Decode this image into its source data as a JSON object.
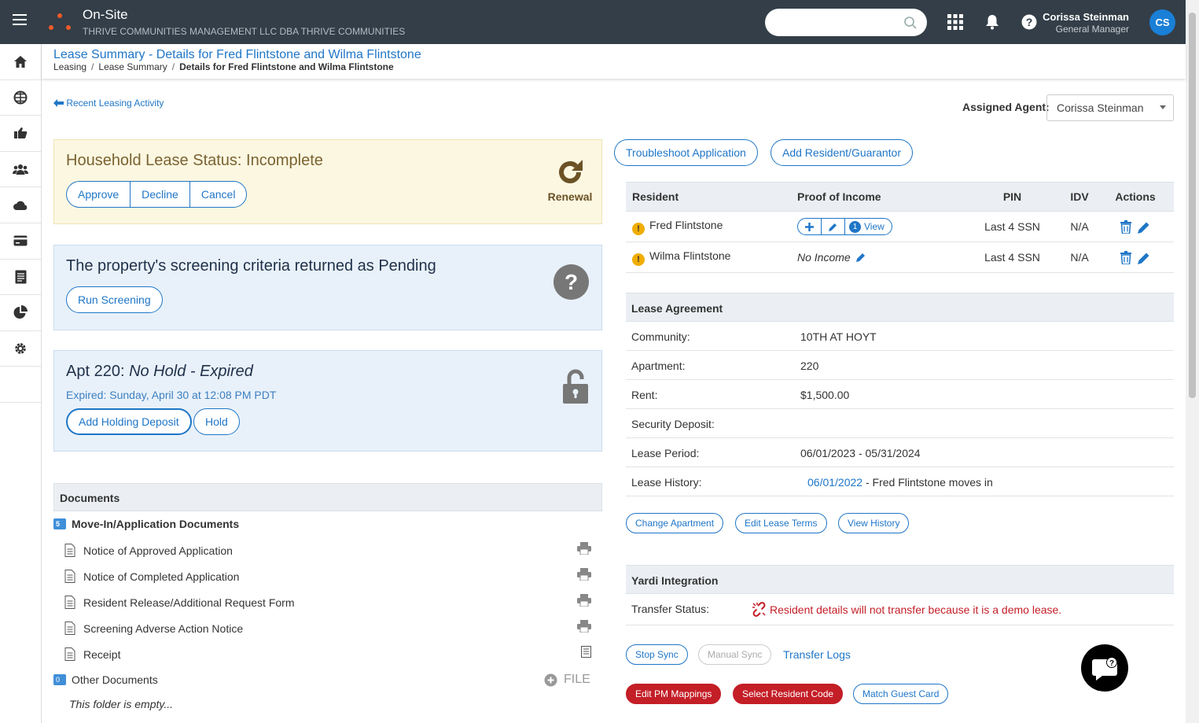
{
  "topbar": {
    "app_name": "On-Site",
    "company": "THRIVE COMMUNITIES MANAGEMENT LLC DBA THRIVE COMMUNITIES",
    "search_placeholder": "",
    "user_name": "Corissa Steinman",
    "user_role": "General Manager",
    "user_initials": "CS"
  },
  "sidebar": {
    "items": [
      "home-icon",
      "globe-icon",
      "thumbs-up-icon",
      "people-icon",
      "cloud-icon",
      "credit-card-icon",
      "document-icon",
      "pie-chart-icon",
      "gear-icon"
    ]
  },
  "header": {
    "title": "Lease Summary - Details for Fred Flintstone and Wilma Flintstone",
    "breadcrumb": [
      "Leasing",
      "Lease Summary",
      "Details for Fred Flintstone and Wilma Flintstone"
    ]
  },
  "back_link": "Recent Leasing Activity",
  "agent": {
    "label": "Assigned Agent:",
    "value": "Corissa Steinman"
  },
  "lease_status": {
    "title": "Household Lease Status: Incomplete",
    "buttons": [
      "Approve",
      "Decline",
      "Cancel"
    ],
    "renewal_label": "Renewal"
  },
  "screening": {
    "title": "The property's screening criteria returned as Pending",
    "button": "Run Screening"
  },
  "hold": {
    "title_prefix": "Apt 220: ",
    "title_status": "No Hold - Expired",
    "expired_text": "Expired: Sunday, April 30 at 12:08 PM PDT",
    "add_deposit": "Add Holding Deposit",
    "hold": "Hold"
  },
  "documents": {
    "heading": "Documents",
    "folder1": {
      "label": "Move-In/Application Documents",
      "count": "5"
    },
    "items": [
      "Notice of Approved Application",
      "Notice of Completed Application",
      "Resident Release/Additional Request Form",
      "Screening Adverse Action Notice",
      "Receipt"
    ],
    "folder2": {
      "label": "Other Documents",
      "count": "0",
      "add_label": "FILE",
      "empty": "This folder is empty..."
    }
  },
  "actions": {
    "troubleshoot": "Troubleshoot Application",
    "add_resident": "Add Resident/Guarantor"
  },
  "residents": {
    "headers": [
      "Resident",
      "Proof of Income",
      "PIN",
      "IDV",
      "Actions"
    ],
    "rows": [
      {
        "name": "Fred Flintstone",
        "income_count": "1",
        "income_view": "View",
        "income_text": "",
        "pin": "Last 4 SSN",
        "idv": "N/A"
      },
      {
        "name": "Wilma Flintstone",
        "income_count": "",
        "income_view": "",
        "income_text": "No Income",
        "pin": "Last 4 SSN",
        "idv": "N/A"
      }
    ]
  },
  "lease": {
    "heading": "Lease Agreement",
    "community_label": "Community:",
    "community": "10TH AT HOYT",
    "apartment_label": "Apartment:",
    "apartment": "220",
    "rent_label": "Rent:",
    "rent": "$1,500.00",
    "deposit_label": "Security Deposit:",
    "deposit": "",
    "period_label": "Lease Period:",
    "period": "06/01/2023 - 05/31/2024",
    "history_label": "Lease History:",
    "history_date": "06/01/2022",
    "history_text": "Fred Flintstone moves in",
    "buttons": [
      "Change Apartment",
      "Edit Lease Terms",
      "View History"
    ]
  },
  "yardi": {
    "heading": "Yardi Integration",
    "status_label": "Transfer Status:",
    "status_text": "Resident details will not transfer because it is a demo lease.",
    "stop_sync": "Stop Sync",
    "manual_sync": "Manual Sync",
    "transfer_logs": "Transfer Logs",
    "edit_pm": "Edit PM Mappings",
    "select_code": "Select Resident Code",
    "match_guest": "Match Guest Card"
  },
  "colors": {
    "accent": "#1f76c7",
    "topbar": "#333e48",
    "danger": "#c41e27",
    "warning": "#f0ad00"
  }
}
